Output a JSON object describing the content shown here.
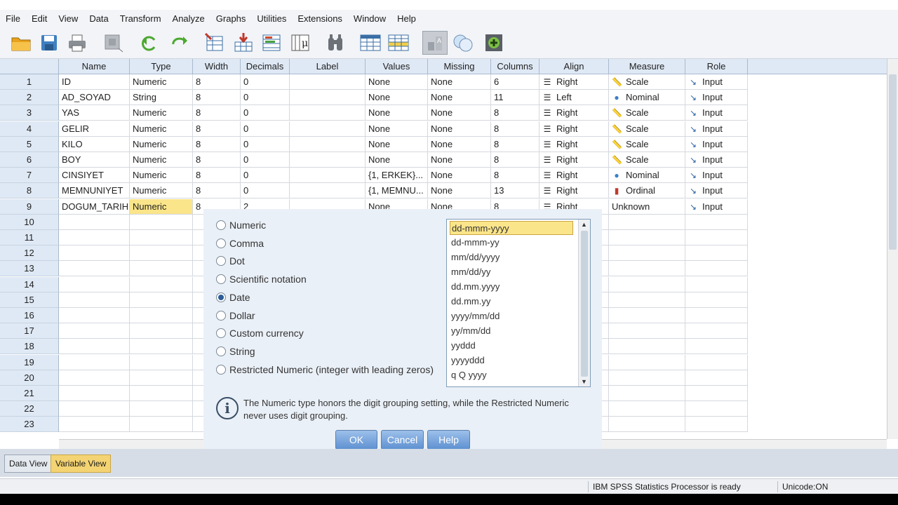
{
  "menu": [
    "File",
    "Edit",
    "View",
    "Data",
    "Transform",
    "Analyze",
    "Graphs",
    "Utilities",
    "Extensions",
    "Window",
    "Help"
  ],
  "toolbar_icons": [
    "open-icon",
    "save-icon",
    "print-icon",
    "dialog-recall-icon",
    "undo-icon",
    "redo-icon",
    "goto-case-icon",
    "goto-variable-icon",
    "variables-icon",
    "run-descriptives-icon",
    "find-icon",
    "split-file-icon",
    "select-cases-icon",
    "weight-cases-icon",
    "value-labels-icon",
    "use-variable-sets-icon"
  ],
  "grid": {
    "headers": [
      "Name",
      "Type",
      "Width",
      "Decimals",
      "Label",
      "Values",
      "Missing",
      "Columns",
      "Align",
      "Measure",
      "Role"
    ],
    "rows": [
      {
        "n": "1",
        "name": "ID",
        "type": "Numeric",
        "width": "8",
        "decimals": "0",
        "label": "",
        "values": "None",
        "missing": "None",
        "columns": "6",
        "align": "Right",
        "measure": "Scale",
        "role": "Input"
      },
      {
        "n": "2",
        "name": "AD_SOYAD",
        "type": "String",
        "width": "8",
        "decimals": "0",
        "label": "",
        "values": "None",
        "missing": "None",
        "columns": "11",
        "align": "Left",
        "measure": "Nominal",
        "role": "Input"
      },
      {
        "n": "3",
        "name": "YAS",
        "type": "Numeric",
        "width": "8",
        "decimals": "0",
        "label": "",
        "values": "None",
        "missing": "None",
        "columns": "8",
        "align": "Right",
        "measure": "Scale",
        "role": "Input"
      },
      {
        "n": "4",
        "name": "GELIR",
        "type": "Numeric",
        "width": "8",
        "decimals": "0",
        "label": "",
        "values": "None",
        "missing": "None",
        "columns": "8",
        "align": "Right",
        "measure": "Scale",
        "role": "Input"
      },
      {
        "n": "5",
        "name": "KILO",
        "type": "Numeric",
        "width": "8",
        "decimals": "0",
        "label": "",
        "values": "None",
        "missing": "None",
        "columns": "8",
        "align": "Right",
        "measure": "Scale",
        "role": "Input"
      },
      {
        "n": "6",
        "name": "BOY",
        "type": "Numeric",
        "width": "8",
        "decimals": "0",
        "label": "",
        "values": "None",
        "missing": "None",
        "columns": "8",
        "align": "Right",
        "measure": "Scale",
        "role": "Input"
      },
      {
        "n": "7",
        "name": "CINSIYET",
        "type": "Numeric",
        "width": "8",
        "decimals": "0",
        "label": "",
        "values": "{1, ERKEK}...",
        "missing": "None",
        "columns": "8",
        "align": "Right",
        "measure": "Nominal",
        "role": "Input"
      },
      {
        "n": "8",
        "name": "MEMNUNIYET",
        "type": "Numeric",
        "width": "8",
        "decimals": "0",
        "label": "",
        "values": "{1, MEMNU...",
        "missing": "None",
        "columns": "13",
        "align": "Right",
        "measure": "Ordinal",
        "role": "Input"
      },
      {
        "n": "9",
        "name": "DOGUM_TARIHI",
        "type": "Numeric",
        "width": "8",
        "decimals": "2",
        "label": "",
        "values": "None",
        "missing": "None",
        "columns": "8",
        "align": "Right",
        "measure": "Unknown",
        "role": "Input"
      }
    ],
    "empty_rows": [
      "10",
      "11",
      "12",
      "13",
      "14",
      "15",
      "16",
      "17",
      "18",
      "19",
      "20",
      "21",
      "22",
      "23"
    ]
  },
  "dialog": {
    "radios": [
      {
        "label": "Numeric",
        "checked": false
      },
      {
        "label": "Comma",
        "checked": false
      },
      {
        "label": "Dot",
        "checked": false
      },
      {
        "label": "Scientific notation",
        "checked": false
      },
      {
        "label": "Date",
        "checked": true
      },
      {
        "label": "Dollar",
        "checked": false
      },
      {
        "label": "Custom currency",
        "checked": false
      },
      {
        "label": "String",
        "checked": false
      },
      {
        "label": "Restricted Numeric (integer with leading zeros)",
        "checked": false
      }
    ],
    "formats": [
      "dd-mmm-yyyy",
      "dd-mmm-yy",
      "mm/dd/yyyy",
      "mm/dd/yy",
      "dd.mm.yyyy",
      "dd.mm.yy",
      "yyyy/mm/dd",
      "yy/mm/dd",
      "yyddd",
      "yyyyddd",
      "q Q yyyy"
    ],
    "selected_format": "dd-mmm-yyyy",
    "info": "The Numeric type honors the digit grouping setting, while the Restricted Numeric never uses digit grouping.",
    "ok": "OK",
    "cancel": "Cancel",
    "help": "Help"
  },
  "tabs": {
    "data_view": "Data View",
    "variable_view": "Variable View",
    "active": "Variable View"
  },
  "status": {
    "processor": "IBM SPSS Statistics Processor is ready",
    "unicode": "Unicode:ON"
  }
}
